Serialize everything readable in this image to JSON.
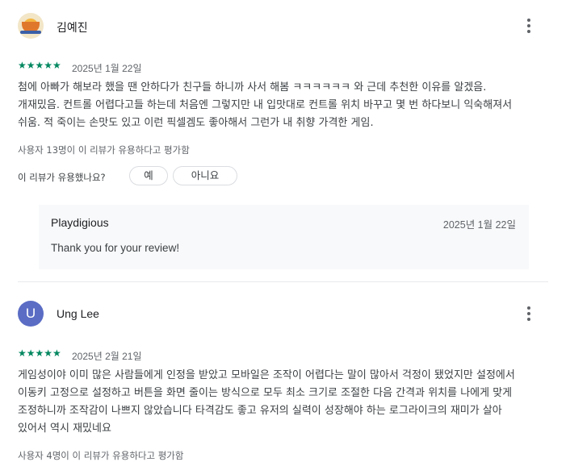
{
  "reviews": [
    {
      "author": "김예진",
      "rating_stars": "★★★★★",
      "rating": 5,
      "date": "2025년 1월 22일",
      "text": "첨에 아빠가 해보라 했을 땐 안하다가 친구들 하니까 사서 해봄 ㅋㅋㅋㅋㅋㅋ 와 근데 추천한 이유를 알겠음. 개재밌음. 컨트롤 어렵다고들 하는데 처음엔 그렇지만 내 입맛대로 컨트롤 위치 바꾸고 몇 번 하다보니 익숙해져서 쉬움. 적 죽이는 손맛도 있고 이런 픽셀겜도 좋아해서 그런가 내 취향 가격한 게임.",
      "helpful_count": "사용자 13명이 이 리뷰가 유용하다고 평가함",
      "helpful_question": "이 리뷰가 유용했나요?",
      "yes_label": "예",
      "no_label": "아니요",
      "reply": {
        "author": "Playdigious",
        "date": "2025년 1월 22일",
        "text": "Thank you for your review!"
      }
    },
    {
      "author": "Ung Lee",
      "avatar_letter": "U",
      "rating_stars": "★★★★★",
      "rating": 5,
      "date": "2025년 2월 21일",
      "text": "게임성이야 이미 많은 사람들에게 인정을 받았고 모바일은 조작이 어렵다는 말이 많아서 걱정이 됐었지만 설정에서 이동키 고정으로 설정하고 버튼을 화면 줄이는 방식으로 모두 최소 크기로 조절한 다음 간격과 위치를 나에게 맞게 조정하니까 조작감이 나쁘지 않았습니다 타격감도 좋고 유저의 실력이 성장해야 하는 로그라이크의 재미가 살아 있어서 역시 재밌네요",
      "helpful_count": "사용자 4명이 이 리뷰가 유용하다고 평가함"
    }
  ],
  "colors": {
    "star": "#01875f",
    "avatar_u": "#5a6cc4",
    "reply_bg": "#f8f9fa"
  }
}
